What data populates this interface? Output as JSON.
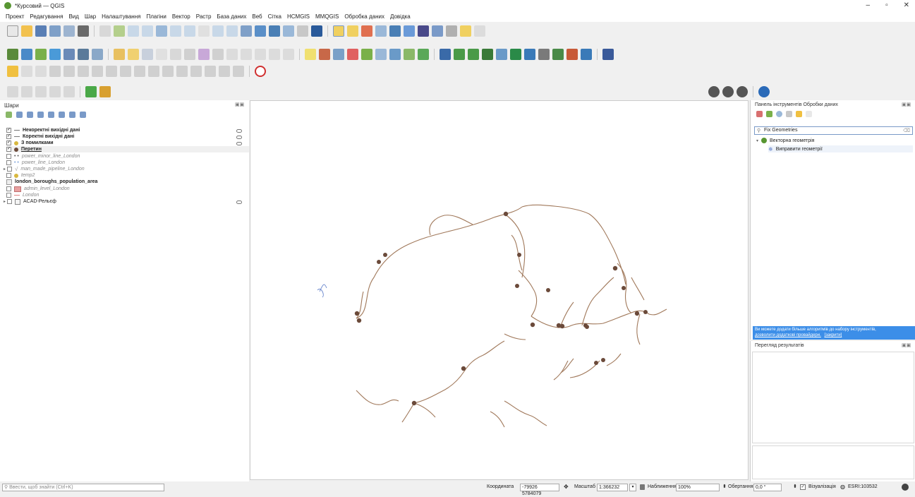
{
  "window": {
    "title": "*Курсовий — QGIS"
  },
  "menu": [
    "Проект",
    "Редагування",
    "Вид",
    "Шар",
    "Налаштування",
    "Плагіни",
    "Вектор",
    "Растр",
    "База даних",
    "Веб",
    "Сітка",
    "HCMGIS",
    "MMQGIS",
    "Обробка даних",
    "Довідка"
  ],
  "layers_panel": {
    "title": "Шари",
    "items": [
      {
        "label": "Некоректні вихідні дані",
        "checked": "✓",
        "style": "bold"
      },
      {
        "label": "Коректні вихідні дані",
        "checked": "✓",
        "style": "bold"
      },
      {
        "label": "З помилками",
        "checked": "✓",
        "style": "bold"
      },
      {
        "label": "Перетин",
        "checked": "✓",
        "style": "bold"
      },
      {
        "label": "power_minor_line_London",
        "checked": "",
        "style": "italic"
      },
      {
        "label": "power_line_London",
        "checked": "",
        "style": "italic"
      },
      {
        "label": "man_made_pipeline_London",
        "checked": "",
        "style": "italic"
      },
      {
        "label": "temp2",
        "checked": "",
        "style": "italic"
      },
      {
        "label": "london_boroughs_population_area",
        "checked": "",
        "style": "bold"
      },
      {
        "label": "admin_level_London",
        "checked": "",
        "style": "italic"
      },
      {
        "label": "London",
        "checked": "",
        "style": "italic"
      },
      {
        "label": "ACAD-Рельєф",
        "checked": "",
        "style": "normal"
      }
    ]
  },
  "processing_panel": {
    "title": "Панель інструментів Обробки даних",
    "search_value": "Fix Geometries",
    "group_label": "Векторна геометрія",
    "algorithm_label": "Виправити геометрії",
    "info_text_1": "Ви можете додати більше алгоритмів до набору інструментів,",
    "info_link": "дозволити додаткові провайдери.",
    "info_close": "[закрити]"
  },
  "results_panel": {
    "title": "Перегляд результатів"
  },
  "status": {
    "search_placeholder": "Ввести, щоб знайти (Ctrl+K)",
    "coord_label": "Координата",
    "coord_value": "-79926  5784079",
    "scale_label": "Масштаб",
    "scale_value": "1:366232",
    "magnifier_label": "Наближення",
    "magnifier_value": "100%",
    "rotation_label": "Обертання",
    "rotation_value": "0,0 °",
    "render_label": "Візуалізація",
    "crs_label": "ESRI:103532"
  },
  "colors": {
    "qgis_green": "#589632",
    "line": "#a0785a",
    "node": "#6b4a3a",
    "info_bg": "#3c8ee8"
  }
}
